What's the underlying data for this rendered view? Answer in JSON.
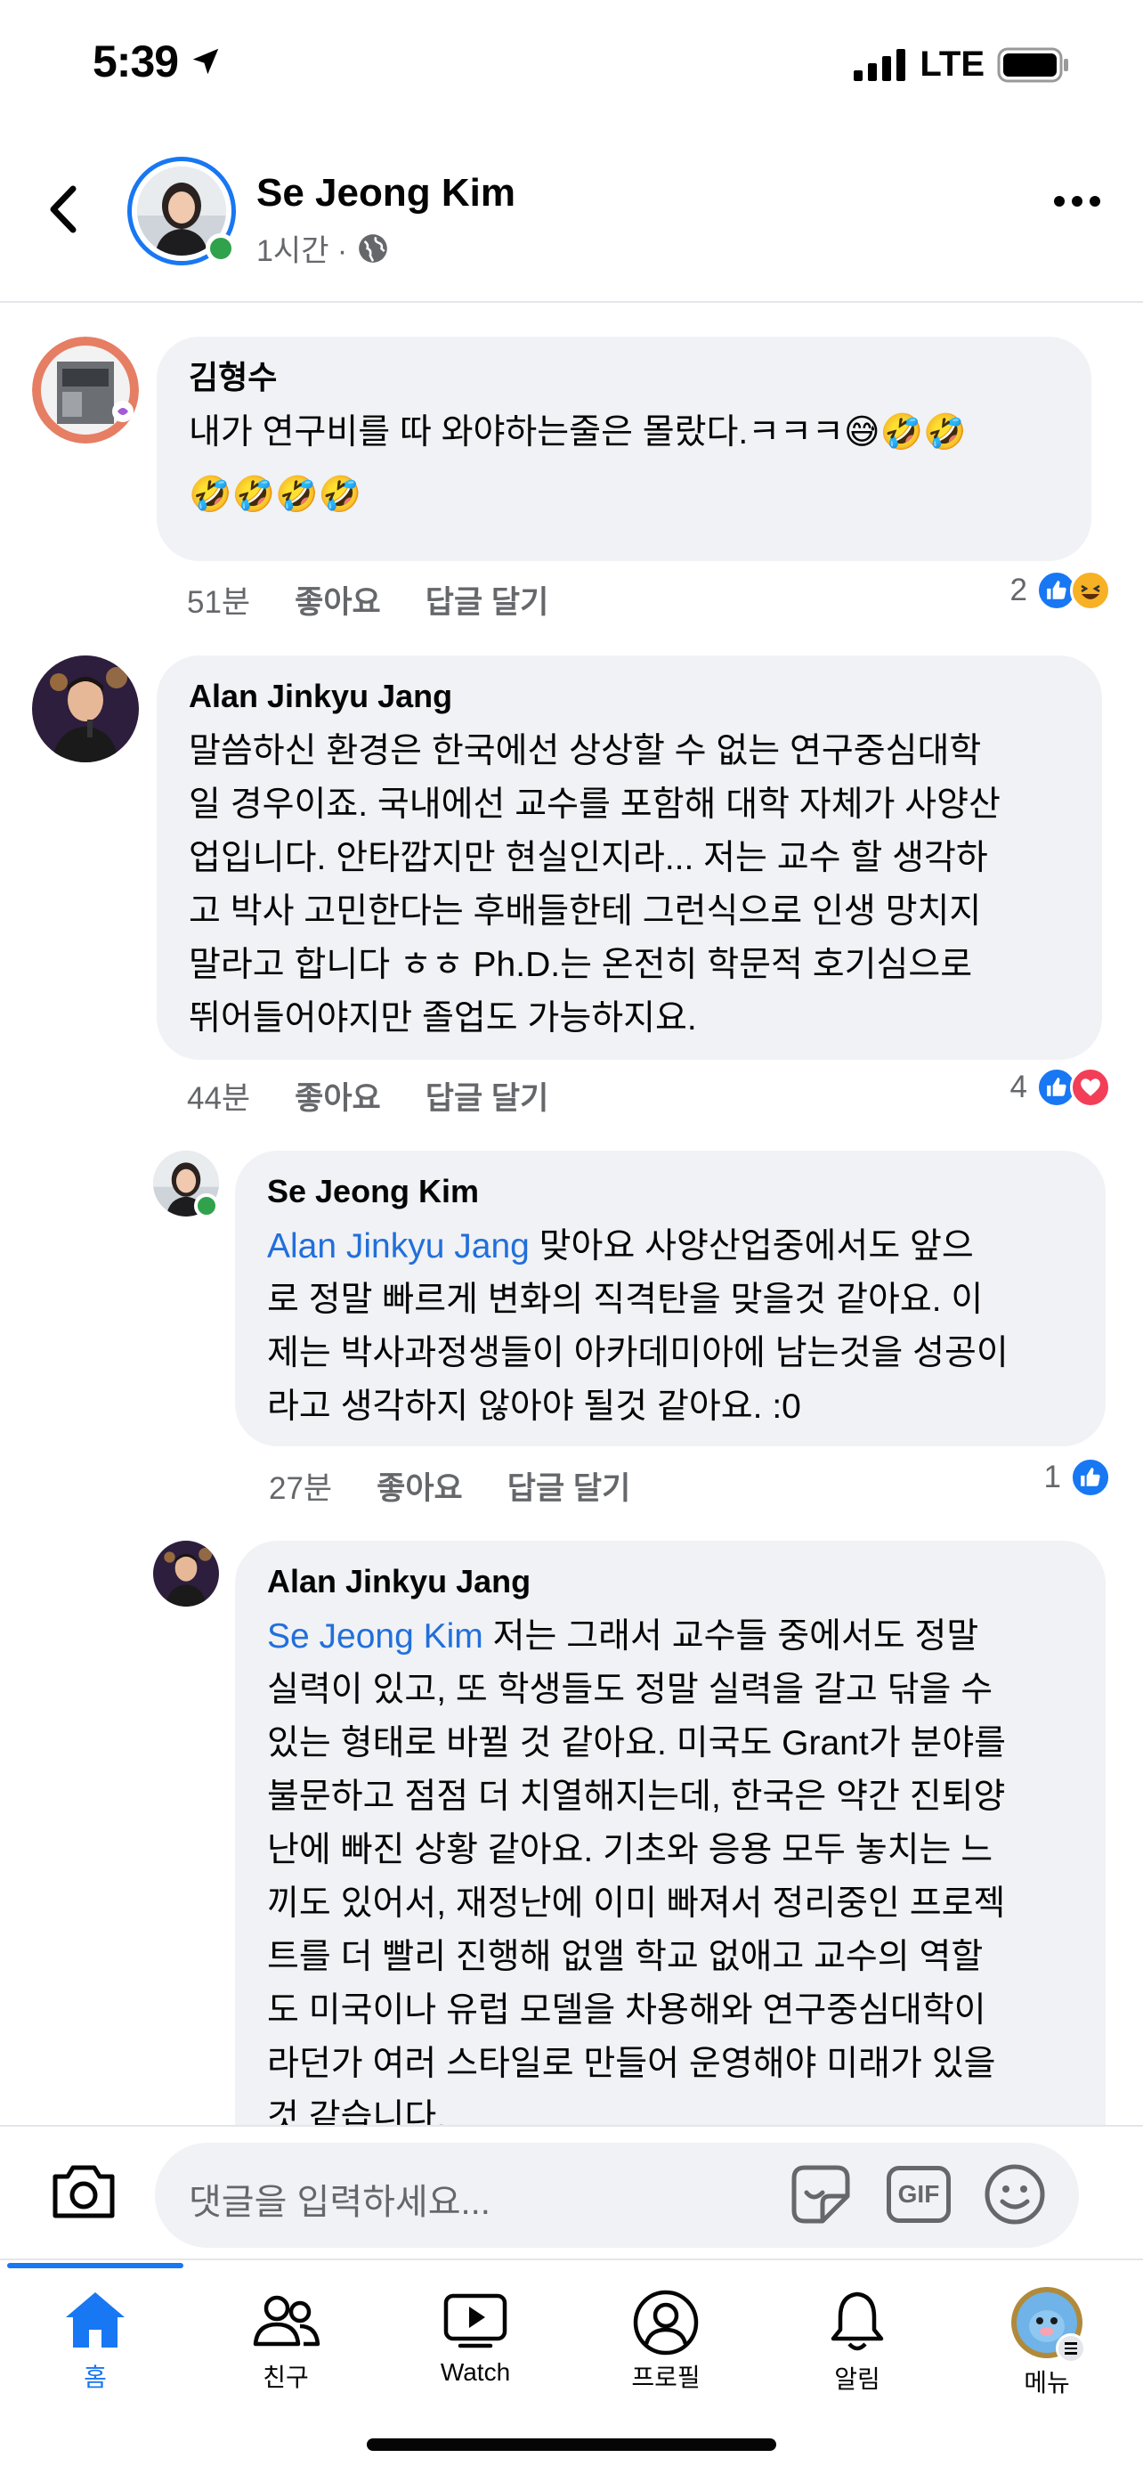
{
  "status": {
    "time": "5:39",
    "network": "LTE"
  },
  "header": {
    "name": "Se Jeong Kim",
    "time": "1시간 ·"
  },
  "comments": [
    {
      "name": "김형수",
      "text": "내가 연구비를 따 와야하는줄은 몰랐다.ㅋㅋㅋ😅🤣🤣",
      "text2": "🤣🤣🤣🤣",
      "time": "51분",
      "like": "좋아요",
      "reply": "답글 달기",
      "reactions": "2"
    },
    {
      "name": "Alan Jinkyu Jang",
      "lines": [
        "말씀하신 환경은 한국에선 상상할 수 없는 연구중심대학",
        "일 경우이죠. 국내에선 교수를 포함해 대학 자체가 사양산",
        "업입니다. 안타깝지만 현실인지라... 저는 교수 할 생각하",
        "고 박사 고민한다는 후배들한테 그런식으로 인생 망치지",
        "말라고 합니다 ㅎㅎ Ph.D.는 온전히 학문적 호기심으로",
        "뛰어들어야지만 졸업도 가능하지요."
      ],
      "time": "44분",
      "like": "좋아요",
      "reply": "답글 달기",
      "reactions": "4"
    },
    {
      "name": "Se Jeong Kim",
      "mention": "Alan Jinkyu Jang",
      "lines": [
        " 맞아요 사양산업중에서도 앞으",
        "로 정말 빠르게 변화의 직격탄을 맞을것 같아요. 이",
        "제는 박사과정생들이 아카데미아에 남는것을 성공이",
        "라고 생각하지 않아야 될것 같아요. :0"
      ],
      "time": "27분",
      "like": "좋아요",
      "reply": "답글 달기",
      "reactions": "1"
    },
    {
      "name": "Alan Jinkyu Jang",
      "mention": "Se Jeong Kim",
      "lines": [
        " 저는 그래서 교수들 중에서도 정말",
        "실력이 있고, 또 학생들도 정말 실력을 갈고 닦을 수",
        "있는 형태로 바뀔 것 같아요. 미국도 Grant가 분야를",
        "불문하고 점점 더 치열해지는데, 한국은 약간 진퇴양",
        "난에 빠진 상황 같아요. 기초와 응용 모두 놓치는 느",
        "끼도 있어서, 재정난에 이미 빠져서 정리중인 프로젝",
        "트를 더 빨리 진행해 없앨 학교 없애고 교수의 역할",
        "도 미국이나 유럽 모델을 차용해와 연구중심대학이",
        "라던가 여러 스타일로 만들어 운영해야 미래가 있을",
        "것 같습니다."
      ]
    }
  ],
  "input": {
    "placeholder": "댓글을 입력하세요...",
    "gif": "GIF"
  },
  "tabs": [
    {
      "label": "홈"
    },
    {
      "label": "친구"
    },
    {
      "label": "Watch"
    },
    {
      "label": "프로필"
    },
    {
      "label": "알림"
    },
    {
      "label": "메뉴"
    }
  ],
  "colors": {
    "accent": "#1877f2",
    "bubble": "#f0f2f5",
    "online": "#31a24c",
    "love": "#f33e58"
  }
}
